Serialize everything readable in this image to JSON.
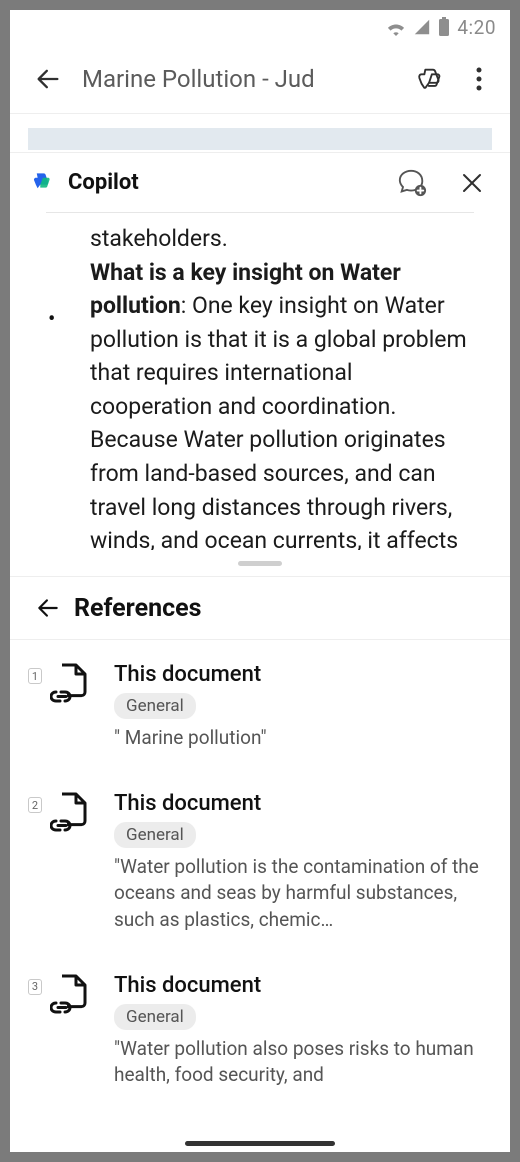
{
  "status": {
    "time": "4:20"
  },
  "header": {
    "title": "Marine Pollution - Jud"
  },
  "copilot": {
    "title": "Copilot",
    "response": {
      "partial_prev": "stakeholders.",
      "bullet_label": "What is a key insight on Water pollution",
      "bullet_text": ": One key insight on Water pollution is that it is a global problem that requires international cooperation and coordination. Because Water pollution originates from land-based sources, and can travel long distances through rivers, winds, and ocean currents, it affects regions far from its"
    }
  },
  "references": {
    "title": "References",
    "items": [
      {
        "num": "1",
        "title": "This document",
        "tag": "General",
        "snippet": "\" Marine pollution\""
      },
      {
        "num": "2",
        "title": "This document",
        "tag": "General",
        "snippet": "\"Water pollution is the contamination of the oceans and seas by harmful substances, such as plastics, chemic…"
      },
      {
        "num": "3",
        "title": "This document",
        "tag": "General",
        "snippet": "\"Water pollution also poses risks to human health, food security, and"
      }
    ]
  }
}
